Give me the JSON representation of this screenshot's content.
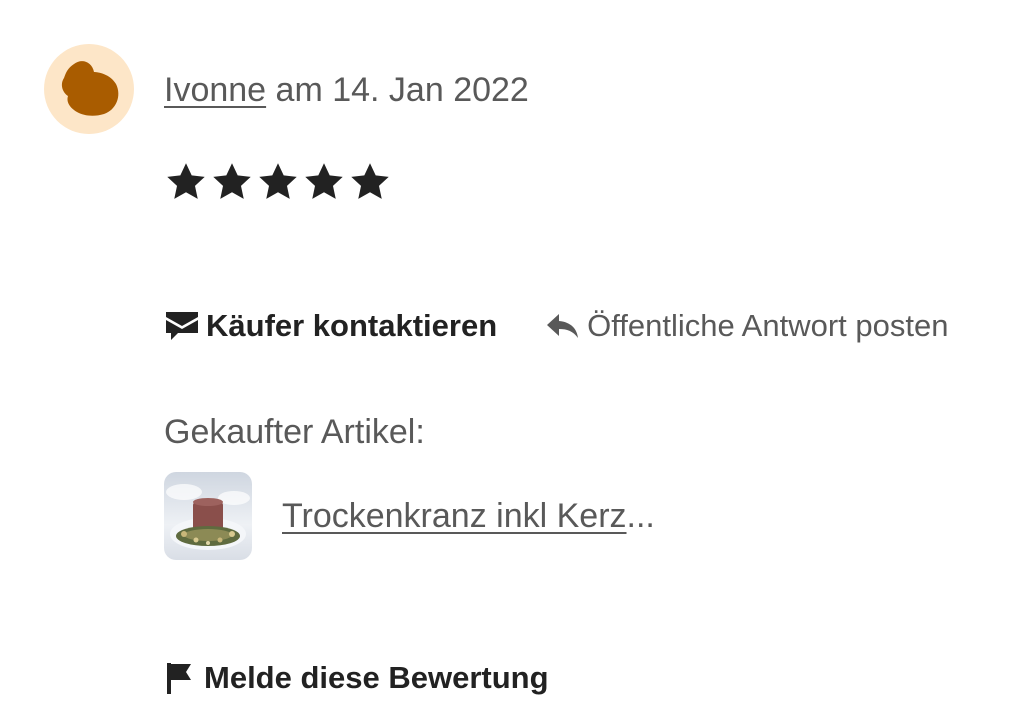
{
  "review": {
    "reviewer_name": "Ivonne",
    "date_text": "am 14. Jan 2022",
    "rating": 5,
    "stars_max": 5,
    "avatar_icon": "user-silhouette-icon",
    "avatar_bg": "#fde6c8",
    "avatar_fg": "#a95c00"
  },
  "actions": {
    "contact_label": "Käufer kontaktieren",
    "contact_icon": "envelope-icon",
    "reply_label": "Öffentliche Antwort posten",
    "reply_icon": "reply-arrow-icon"
  },
  "purchase": {
    "label": "Gekaufter Artikel:",
    "item_title": "Trockenkranz inkl Kerz",
    "item_ellipsis": "...",
    "thumbnail_icon": "wreath-candle-thumbnail"
  },
  "report": {
    "label": "Melde diese Bewertung",
    "icon": "flag-icon"
  }
}
